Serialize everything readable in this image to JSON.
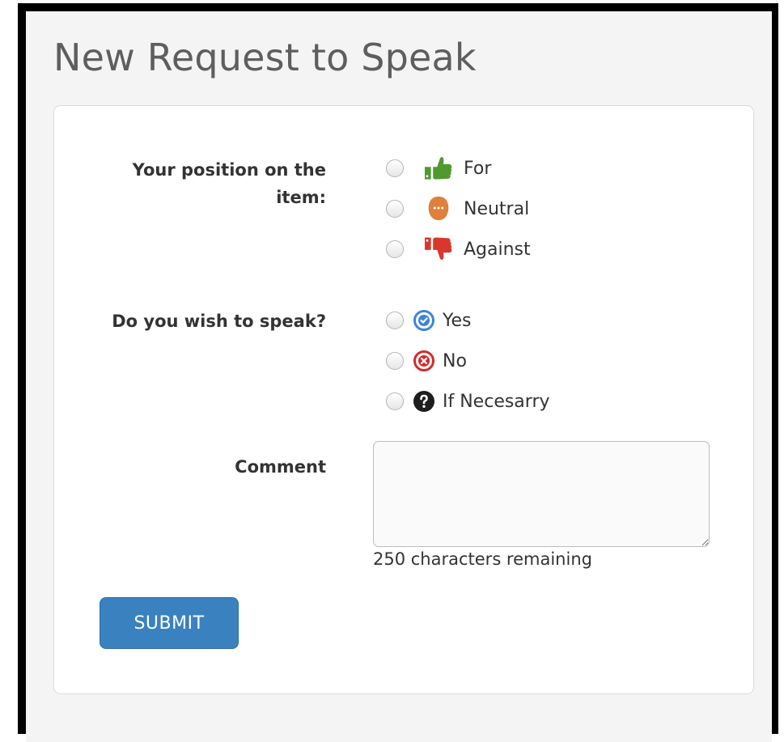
{
  "page": {
    "title": "New Request to Speak"
  },
  "form": {
    "position": {
      "label": "Your position on the item:",
      "options": [
        {
          "label": "For",
          "icon": "thumbs-up-icon",
          "color": "#4e9a2e"
        },
        {
          "label": "Neutral",
          "icon": "neutral-face-icon",
          "color": "#e0803a"
        },
        {
          "label": "Against",
          "icon": "thumbs-down-icon",
          "color": "#d9372d"
        }
      ]
    },
    "speak": {
      "label": "Do you wish to speak?",
      "options": [
        {
          "label": "Yes",
          "icon": "check-circle-icon",
          "color": "#3a86d6"
        },
        {
          "label": "No",
          "icon": "x-circle-icon",
          "color": "#d22b2b"
        },
        {
          "label": "If Necesarry",
          "icon": "question-circle-icon",
          "color": "#1e1e1e"
        }
      ]
    },
    "comment": {
      "label": "Comment",
      "value": "",
      "chars_remaining": "250 characters remaining"
    },
    "submit_label": "SUBMIT"
  },
  "colors": {
    "accent": "#3a81c0",
    "panel_bg": "#f4f4f4"
  }
}
